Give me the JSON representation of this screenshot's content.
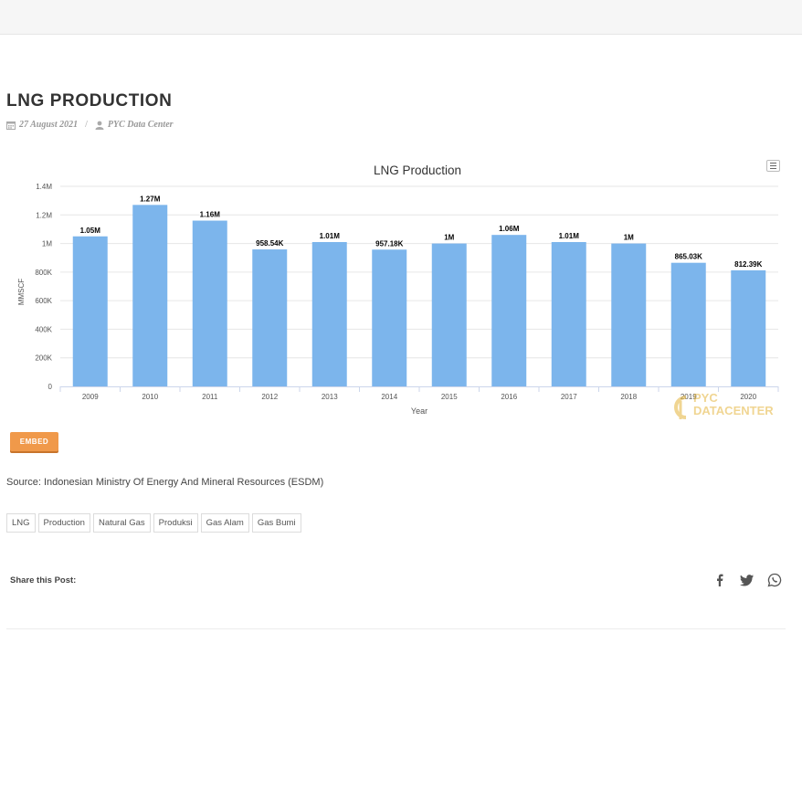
{
  "post": {
    "title": "LNG PRODUCTION",
    "date": "27 August 2021",
    "date_sep": "/",
    "author": "PYC Data Center",
    "source": "Source: Indonesian Ministry Of Energy And Mineral Resources (ESDM)",
    "embed_label": "EMBED",
    "share_label": "Share this Post:",
    "tags": [
      "LNG",
      "Production",
      "Natural Gas",
      "Produksi",
      "Gas Alam",
      "Gas Bumi"
    ],
    "share_icons": [
      "facebook-icon",
      "twitter-icon",
      "whatsapp-icon"
    ]
  },
  "watermark": {
    "line1": "PYC",
    "line2": "DATACENTER"
  },
  "chart_data": {
    "type": "bar",
    "title": "LNG Production",
    "xlabel": "Year",
    "ylabel": "MMSCF",
    "categories": [
      "2009",
      "2010",
      "2011",
      "2012",
      "2013",
      "2014",
      "2015",
      "2016",
      "2017",
      "2018",
      "2019",
      "2020"
    ],
    "series": [
      {
        "values": [
          1050000,
          1270000,
          1160000,
          958540,
          1010000,
          957180,
          1000000,
          1060000,
          1010000,
          1000000,
          865030,
          812390
        ],
        "labels": [
          "1.05M",
          "1.27M",
          "1.16M",
          "958.54K",
          "1.01M",
          "957.18K",
          "1M",
          "1.06M",
          "1.01M",
          "1M",
          "865.03K",
          "812.39K"
        ]
      }
    ],
    "ylim": [
      0,
      1400000
    ],
    "yticks": [
      0,
      200000,
      400000,
      600000,
      800000,
      1000000,
      1200000,
      1400000
    ],
    "ytick_labels": [
      "0",
      "200K",
      "400K",
      "600K",
      "800K",
      "1M",
      "1.2M",
      "1.4M"
    ],
    "grid": true,
    "legend": "none",
    "colors": {
      "bar": "#7cb5ec",
      "grid": "#e6e6e6",
      "axis": "#ccd6eb"
    }
  }
}
